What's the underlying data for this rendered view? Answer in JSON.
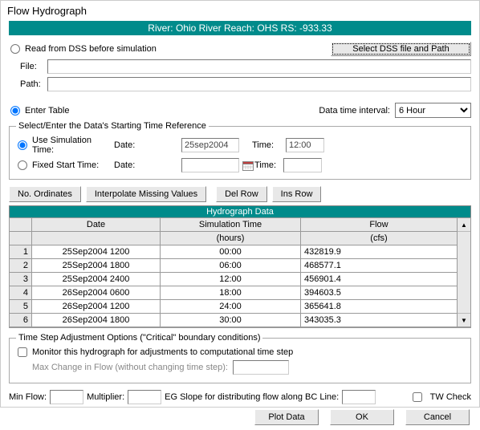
{
  "window_title": "Flow Hydrograph",
  "river_bar": "River: Ohio River  Reach: OHS  RS: -933.33",
  "dss": {
    "read_label": "Read from DSS before simulation",
    "select_btn": "Select DSS file and Path",
    "file_label": "File:",
    "file_value": "",
    "path_label": "Path:",
    "path_value": ""
  },
  "table_mode": {
    "enter_label": "Enter Table",
    "interval_label": "Data time interval:",
    "interval_value": "6 Hour"
  },
  "time_ref": {
    "legend": "Select/Enter the Data's Starting Time Reference",
    "use_sim_label": "Use Simulation Time:",
    "fixed_label": "Fixed Start Time:",
    "date_label": "Date:",
    "time_label": "Time:",
    "sim_date": "25sep2004",
    "sim_time": "12:00",
    "fixed_date": "",
    "fixed_time": ""
  },
  "buttons": {
    "no_ord": "No. Ordinates",
    "interp": "Interpolate Missing Values",
    "del": "Del Row",
    "ins": "Ins Row"
  },
  "grid": {
    "section": "Hydrograph Data",
    "headers": {
      "date": "Date",
      "sim": "Simulation Time",
      "flow": "Flow"
    },
    "units": {
      "date": "",
      "sim": "(hours)",
      "flow": "(cfs)"
    },
    "rows": [
      {
        "n": "1",
        "date": "25Sep2004 1200",
        "sim": "00:00",
        "flow": "432819.9"
      },
      {
        "n": "2",
        "date": "25Sep2004 1800",
        "sim": "06:00",
        "flow": "468577.1"
      },
      {
        "n": "3",
        "date": "25Sep2004 2400",
        "sim": "12:00",
        "flow": "456901.4"
      },
      {
        "n": "4",
        "date": "26Sep2004 0600",
        "sim": "18:00",
        "flow": "394603.5"
      },
      {
        "n": "5",
        "date": "26Sep2004 1200",
        "sim": "24:00",
        "flow": "365641.8"
      },
      {
        "n": "6",
        "date": "26Sep2004 1800",
        "sim": "30:00",
        "flow": "343035.3"
      }
    ]
  },
  "ts_opts": {
    "legend": "Time Step Adjustment Options (\"Critical\" boundary conditions)",
    "monitor_label": "Monitor this hydrograph for adjustments to computational time step",
    "maxchg_label": "Max Change in Flow (without changing time step):",
    "maxchg_value": ""
  },
  "bottom": {
    "minflow_label": "Min Flow:",
    "minflow": "",
    "mult_label": "Multiplier:",
    "mult": "",
    "slope_label": "EG Slope for distributing flow along BC Line:",
    "slope": "",
    "tw_label": "TW Check"
  },
  "footer": {
    "plot": "Plot Data",
    "ok": "OK",
    "cancel": "Cancel"
  }
}
